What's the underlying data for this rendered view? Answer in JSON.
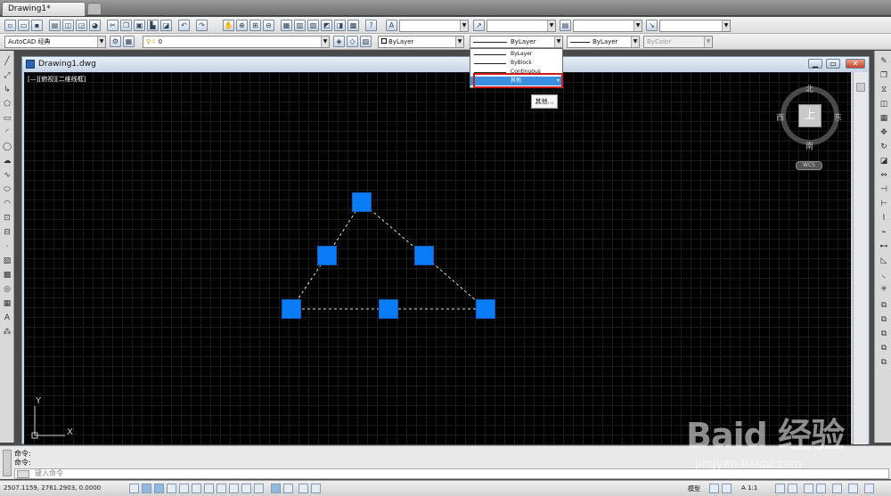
{
  "doc_tab": {
    "title": "Drawing1*"
  },
  "toolbar2": {
    "workspace": "AutoCAD 经典",
    "layer": "0",
    "color": "ByLayer",
    "linetype": "ByLayer",
    "lineweight": "ByLayer",
    "plotstyle": "ByColor"
  },
  "window": {
    "title": "Drawing1.dwg",
    "minimize": "▁",
    "restore": "▭",
    "close": "✕"
  },
  "viewport_label": "[—][俯视][二维线框]",
  "viewcube": {
    "top": "上",
    "north": "北",
    "south": "南",
    "east": "东",
    "west": "西",
    "wcs": "WCS"
  },
  "dropdown": {
    "items": [
      {
        "label": "ByLayer",
        "selected": false
      },
      {
        "label": "ByBlock",
        "selected": false
      },
      {
        "label": "Continuous",
        "selected": false
      },
      {
        "label": "其他",
        "selected": true
      }
    ]
  },
  "tooltip": "其他...",
  "ucs": {
    "x": "X",
    "y": "Y"
  },
  "command": {
    "line1": "命令:",
    "line2": "命令:",
    "placeholder": "键入命令"
  },
  "status": {
    "coords": "2507.1159, 2761.2903, 0.0000",
    "model": "模型",
    "scale": "A 1:1"
  },
  "watermark": {
    "main": "Baid 经验",
    "sub": "jingyan.baidu.com"
  },
  "colors": {
    "grip": "#0a7cf5",
    "highlight": "#d11b1b",
    "selection": "#3b8fe0",
    "canvas": "#000000"
  }
}
